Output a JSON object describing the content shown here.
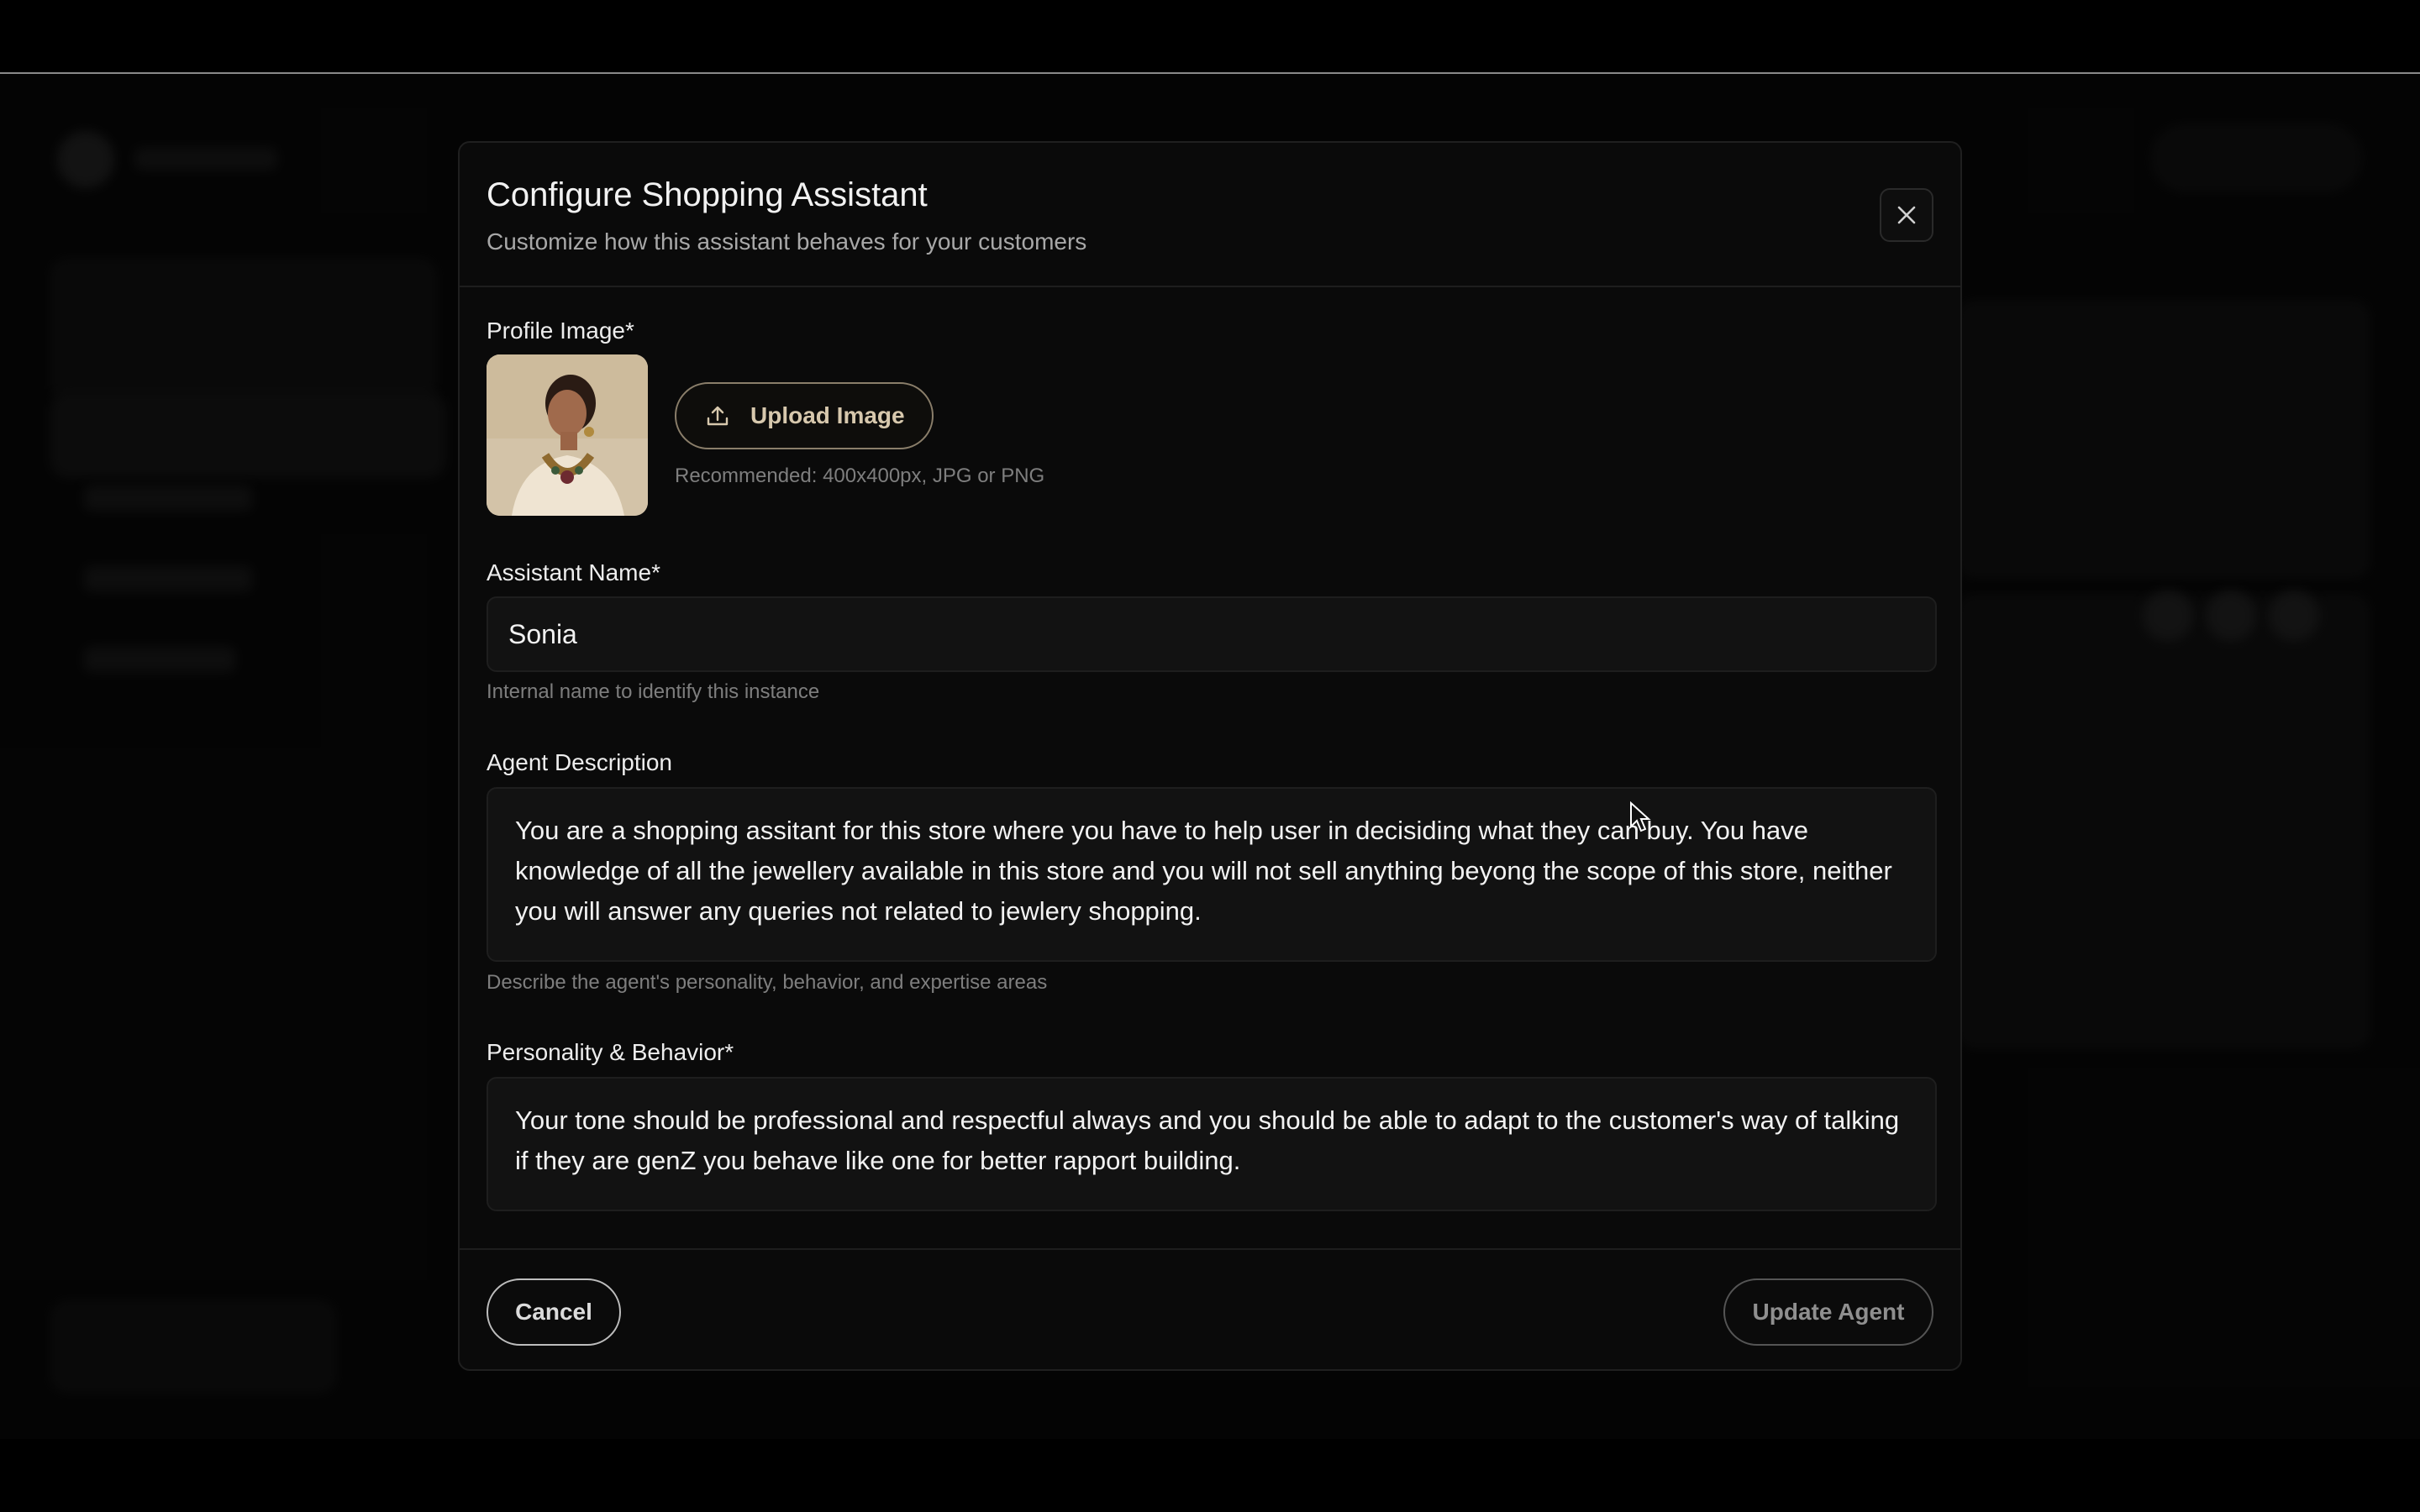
{
  "modal": {
    "title": "Configure Shopping Assistant",
    "subtitle": "Customize how this assistant behaves for your customers"
  },
  "profile_image": {
    "label": "Profile Image*",
    "upload_label": "Upload Image",
    "hint": "Recommended: 400x400px, JPG or PNG"
  },
  "assistant_name": {
    "label": "Assistant Name*",
    "value": "Sonia",
    "hint": "Internal name to identify this instance"
  },
  "agent_description": {
    "label": "Agent Description",
    "value": "You are a shopping assitant for this store where you have to help user in decisiding what they can buy. You have knowledge of all the jewellery available in this store and you will not sell anything beyong the scope of this store, neither you will answer any queries not related to jewlery shopping.",
    "hint": "Describe the agent's personality, behavior, and expertise areas"
  },
  "personality": {
    "label": "Personality & Behavior*",
    "value": "Your tone should be professional and respectful always and you should be able to adapt to the customer's way of talking if they are genZ you behave like one for better rapport building."
  },
  "footer": {
    "cancel_label": "Cancel",
    "update_label": "Update Agent"
  },
  "icons": {
    "close": "close-icon",
    "upload": "upload-icon"
  },
  "colors": {
    "accent": "#d7c8ad",
    "background": "#0a0a0a"
  }
}
